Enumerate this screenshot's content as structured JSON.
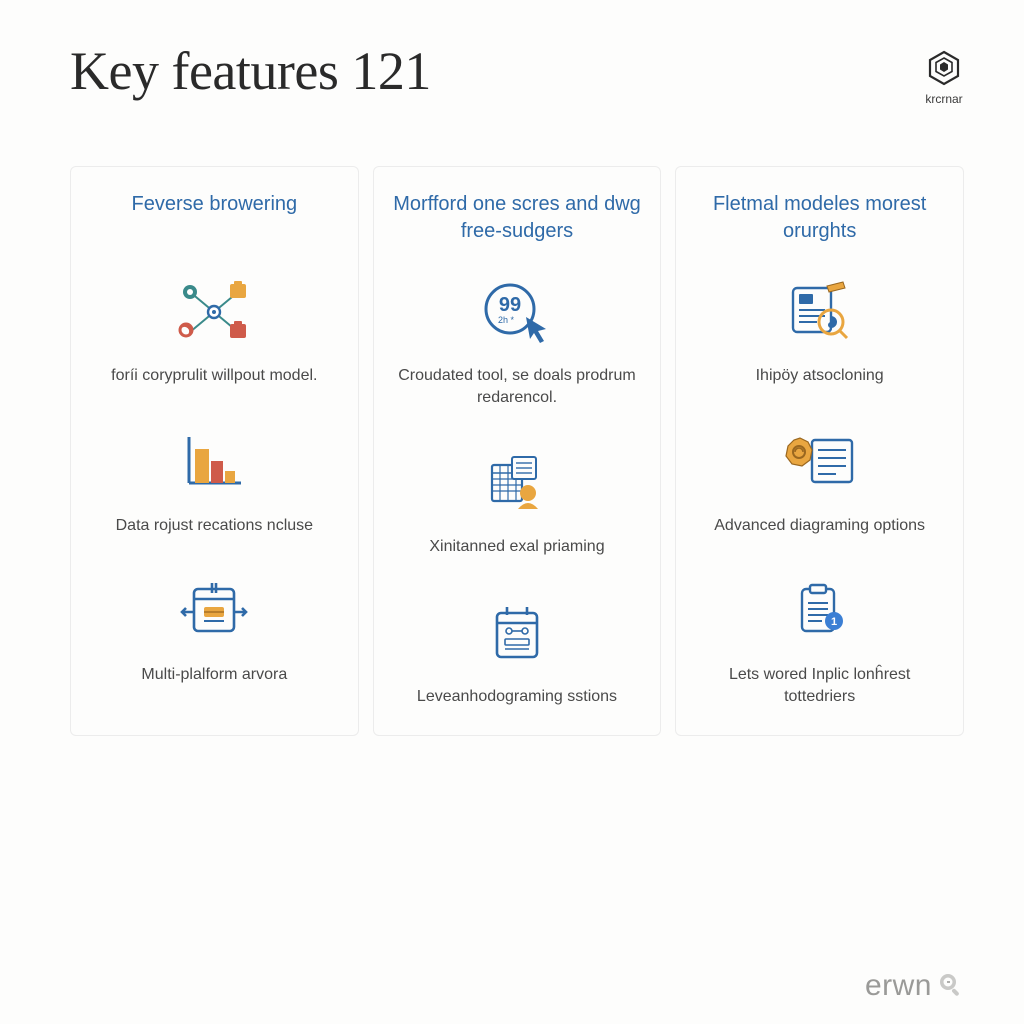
{
  "title": "Key features 121",
  "brand_top_label": "krcrnar",
  "columns": [
    {
      "title": "Feverse browering",
      "features": [
        {
          "icon": "connect-nodes-icon",
          "text": "foríi coryprulit willpout model."
        },
        {
          "icon": "bar-chart-icon",
          "text": "Data rojust recations ncluse"
        },
        {
          "icon": "calendar-arrows-icon",
          "text": "Multi-plalform arvora"
        }
      ]
    },
    {
      "title": "Morfford one scres and dwg free-sudgers",
      "features": [
        {
          "icon": "cursor-badge-icon",
          "text": "Croudated tool, se doals prodrum redarencol."
        },
        {
          "icon": "database-person-icon",
          "text": "Xinitanned exal priaming"
        },
        {
          "icon": "schedule-icon",
          "text": "Leveanhodograming sstions"
        }
      ]
    },
    {
      "title": "Fletmal modeles morest orurghts",
      "features": [
        {
          "icon": "document-edit-icon",
          "text": "Ihipöy atsocloning"
        },
        {
          "icon": "gear-document-icon",
          "text": "Advanced diagraming options"
        },
        {
          "icon": "clipboard-badge-icon",
          "text": "Lets wored Inplic lonĥrest tottedriers"
        }
      ]
    }
  ],
  "footer_brand": "erwn",
  "colors": {
    "accent_blue": "#2f6aa8",
    "text_gray": "#4a4a4a",
    "border": "#ececec",
    "warm_yellow": "#e9a640",
    "warm_red": "#cf5b4a",
    "teal": "#3a8a8a"
  }
}
